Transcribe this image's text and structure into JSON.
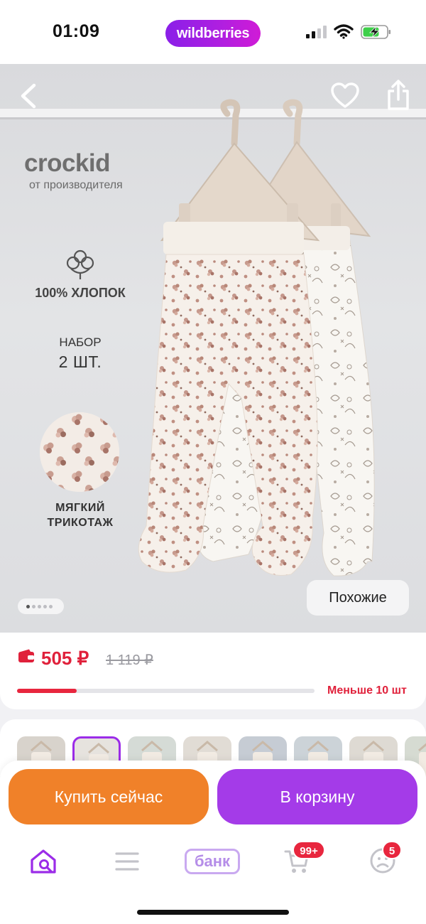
{
  "status_bar": {
    "time": "01:09",
    "brand": "wildberries",
    "brand_gradient": [
      "#8a1fe8",
      "#d01bd6"
    ],
    "icons": [
      "signal-icon",
      "wifi-icon",
      "battery-charging-icon"
    ]
  },
  "product_image": {
    "brand_logo": "crockid",
    "brand_subtitle": "от производителя",
    "feature_cotton": "100% ХЛОПОК",
    "feature_set_label": "НАБОР",
    "feature_set_count": "2 ШТ.",
    "feature_fabric": [
      "МЯГКИЙ",
      "ТРИКОТАЖ"
    ],
    "gallery_current_index": 1,
    "gallery_dot_count": 5,
    "similar_button": "Похожие",
    "icons": [
      "back-arrow-icon",
      "heart-icon",
      "share-icon",
      "cotton-flower-icon"
    ]
  },
  "price": {
    "current": "505 ₽",
    "old": "1 119 ₽",
    "accent_color": "#e0213b",
    "stock_label": "Меньше 10 шт",
    "stock_fraction": 0.2
  },
  "thumbnails": {
    "count": 8,
    "selected_index": 1
  },
  "actions": {
    "buy_now": "Купить сейчас",
    "buy_now_color": "#f08129",
    "add_to_cart": "В корзину",
    "add_to_cart_color": "#a43be8"
  },
  "bottom_nav": {
    "bank_label": "банк",
    "cart_badge": "99+",
    "profile_badge": "5",
    "icons": [
      "home-search-icon",
      "catalog-menu-icon",
      "cart-icon",
      "profile-icon"
    ]
  }
}
